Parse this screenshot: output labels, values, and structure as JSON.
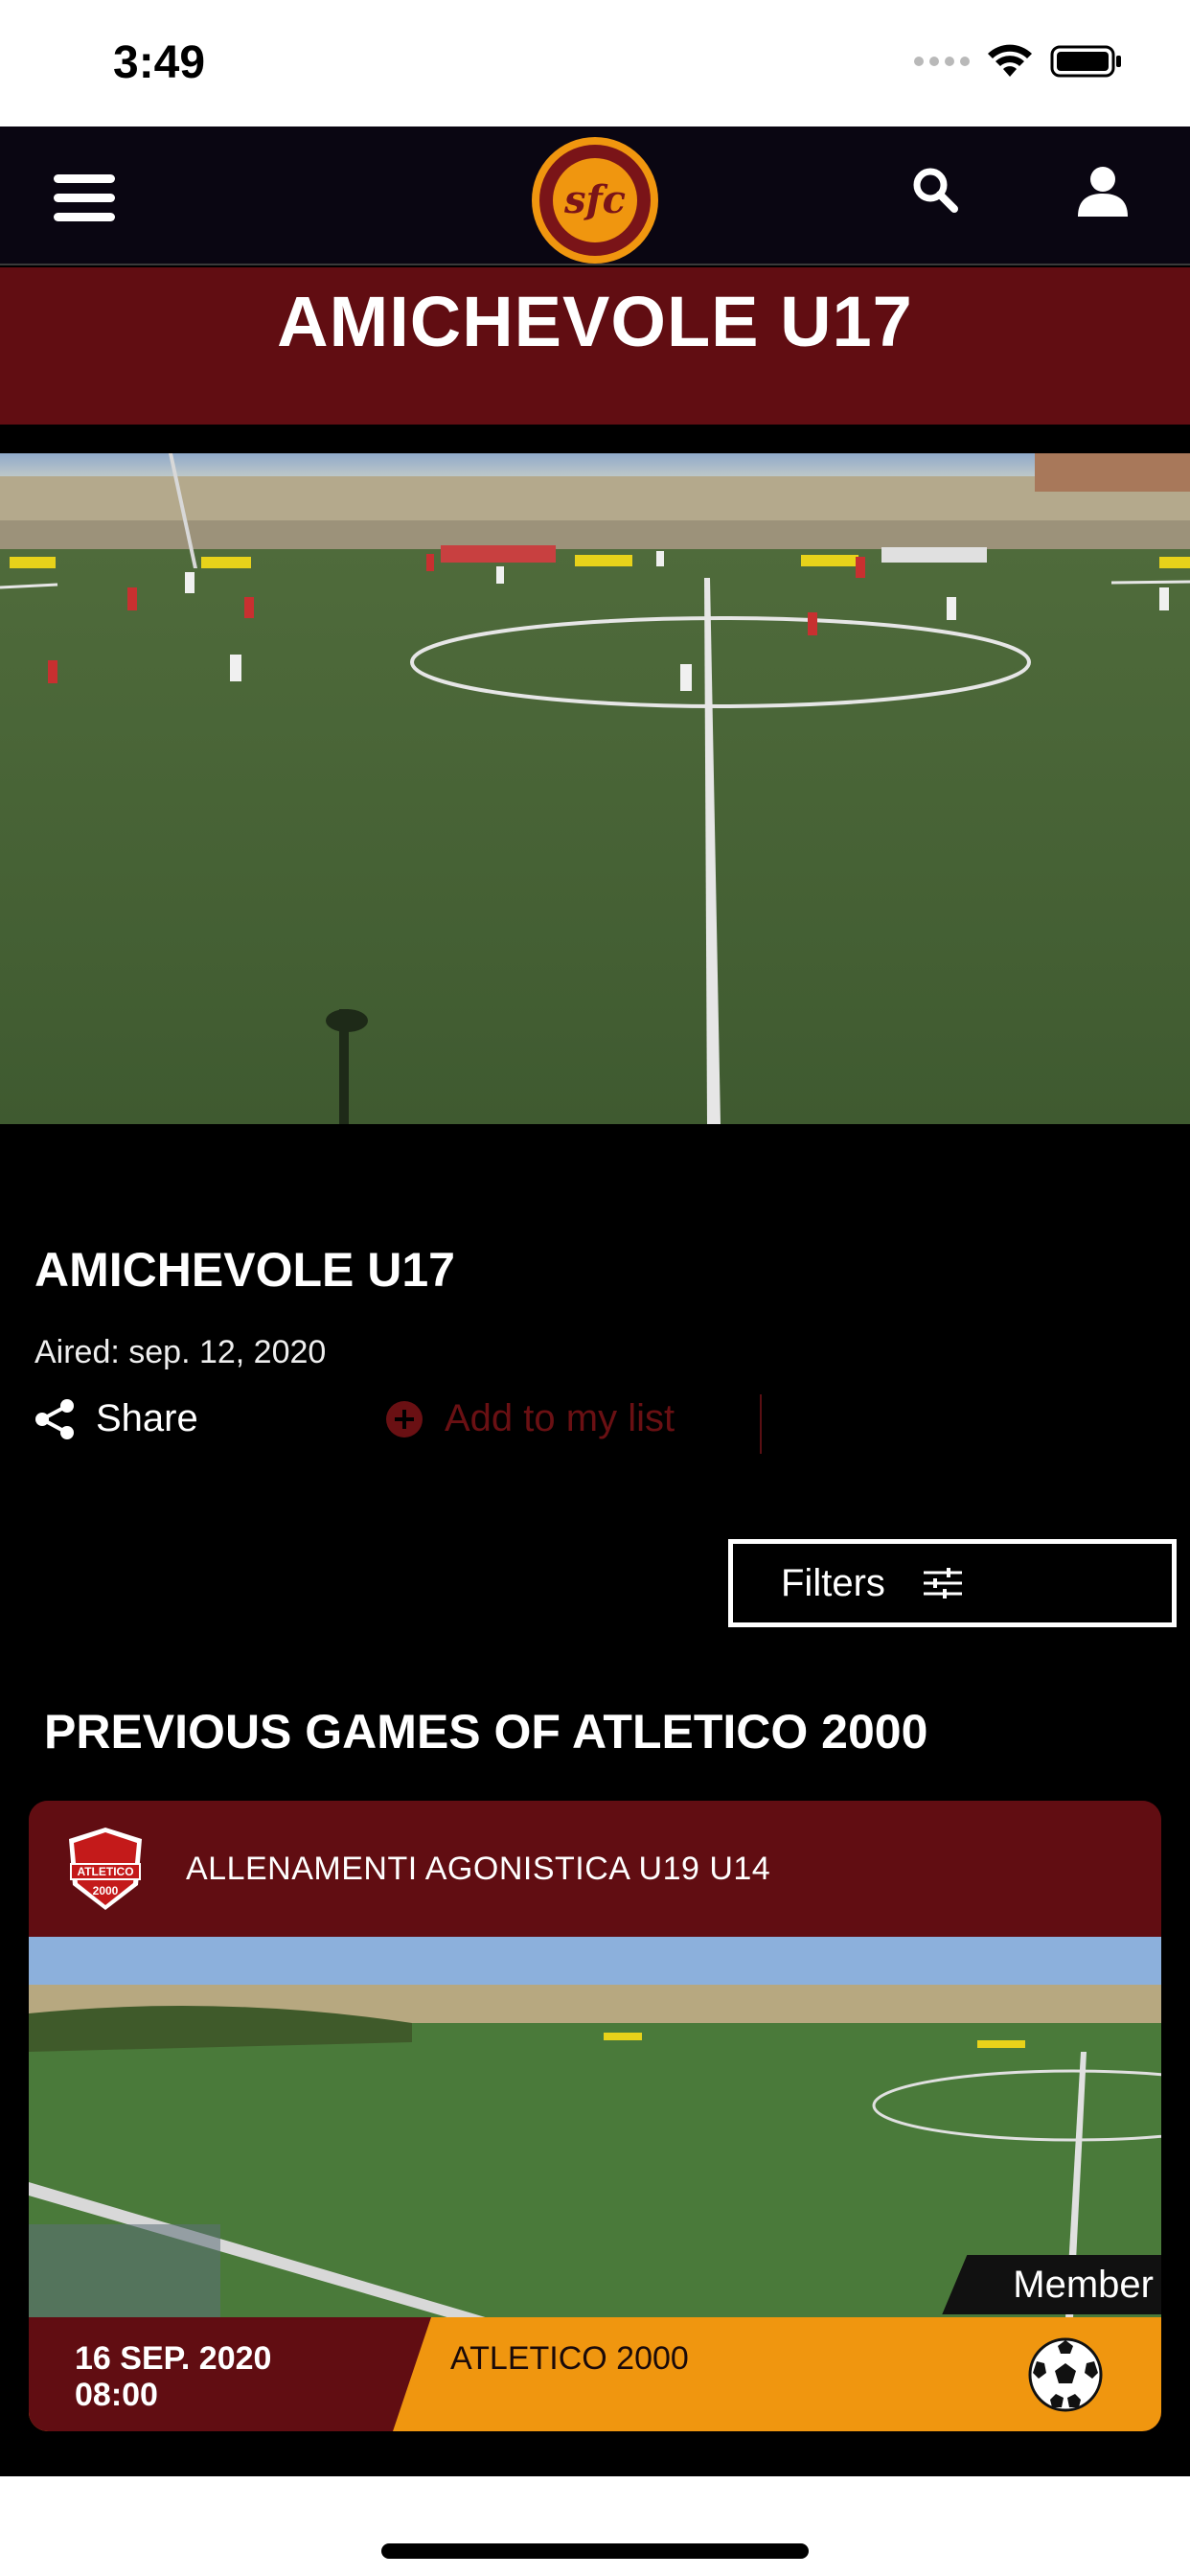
{
  "status_bar": {
    "time": "3:49"
  },
  "header": {
    "logo_text": "sfc"
  },
  "page": {
    "title": "AMICHEVOLE U17"
  },
  "event": {
    "title": "AMICHEVOLE U17",
    "aired": "Aired: sep. 12, 2020",
    "share_label": "Share",
    "add_list_label": "Add to my list"
  },
  "filters": {
    "label": "Filters"
  },
  "section": {
    "title": "PREVIOUS GAMES OF ATLETICO 2000"
  },
  "card": {
    "title": "ALLENAMENTI AGONISTICA U19 U14",
    "badge_text": "ATLETICO",
    "badge_year": "2000",
    "member_label": "Member",
    "date_line1": "16 SEP. 2020",
    "date_line2": "08:00",
    "team_name": "ATLETICO 2000"
  },
  "colors": {
    "brand_maroon": "#610d12",
    "accent_orange": "#f0960f",
    "header_bg": "#0a0612",
    "member_blue": "#1a64c8"
  }
}
